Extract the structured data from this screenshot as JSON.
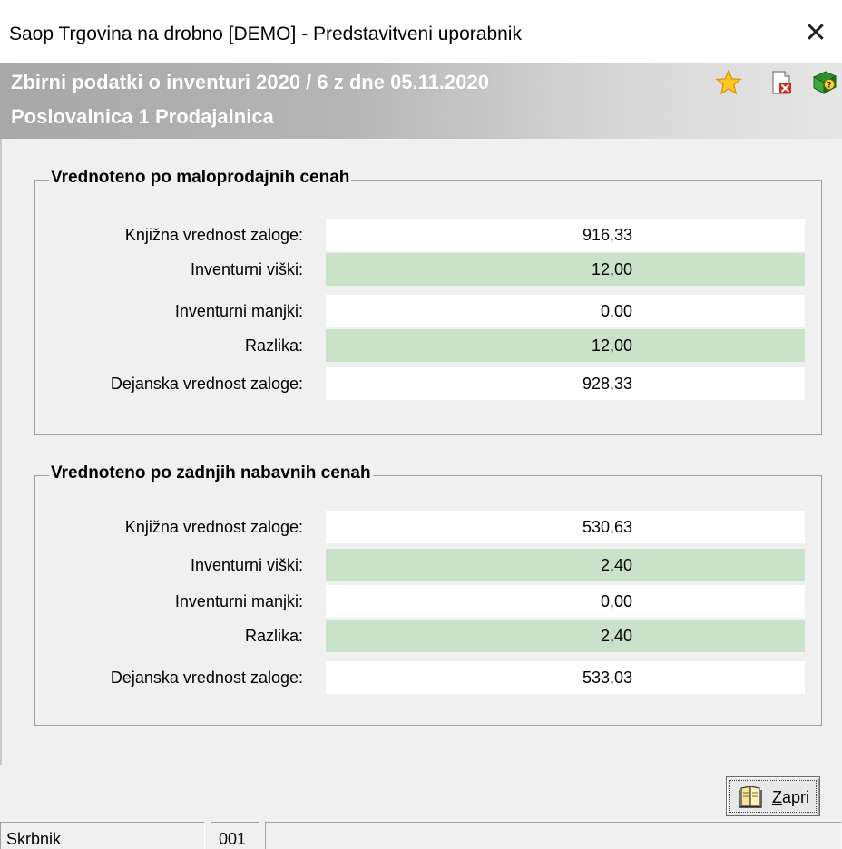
{
  "window": {
    "title": "Saop Trgovina na drobno [DEMO] - Predstavitveni uporabnik",
    "close_glyph": "✕"
  },
  "header": {
    "line1": "Zbirni podatki o inventuri 2020 / 6 z dne 05.11.2020",
    "line2": "Poslovalnica 1 Prodajalnica",
    "icons": [
      "star-icon",
      "pdf-close-icon",
      "help-book-icon"
    ]
  },
  "groups": [
    {
      "title": "Vrednoteno po maloprodajnih cenah",
      "rows": [
        {
          "label": "Knjižna vrednost zaloge:",
          "value": "916,33"
        },
        {
          "label": "Inventurni viški:",
          "value": "12,00"
        },
        {
          "label": "Inventurni manjki:",
          "value": "0,00"
        },
        {
          "label": "Razlika:",
          "value": "12,00"
        },
        {
          "label": "Dejanska vrednost zaloge:",
          "value": "928,33"
        }
      ]
    },
    {
      "title": "Vrednoteno po zadnjih nabavnih cenah",
      "rows": [
        {
          "label": "Knjižna vrednost zaloge:",
          "value": "530,63"
        },
        {
          "label": "Inventurni viški:",
          "value": "2,40"
        },
        {
          "label": "Inventurni manjki:",
          "value": "0,00"
        },
        {
          "label": "Razlika:",
          "value": "2,40"
        },
        {
          "label": "Dejanska vrednost zaloge:",
          "value": "533,03"
        }
      ]
    }
  ],
  "buttons": {
    "close_label_u": "Z",
    "close_label_rest": "apri"
  },
  "statusbar": {
    "user": "Skrbnik",
    "code": "001",
    "extra": ""
  },
  "colors": {
    "alt_row": "#c9e2c9",
    "row": "#ffffff",
    "header_gradient_start": "#a8a8a8"
  }
}
